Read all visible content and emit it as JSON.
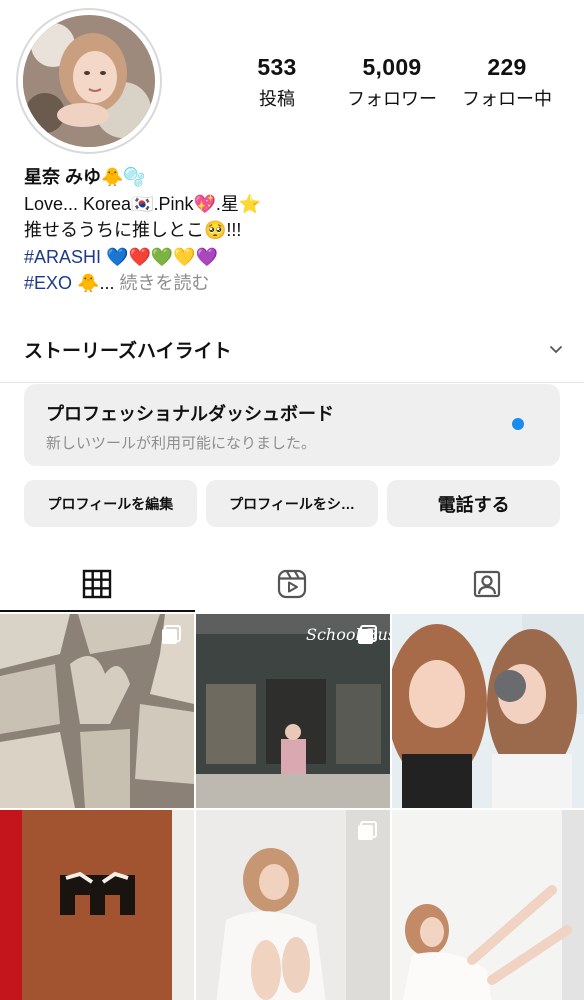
{
  "stats": {
    "posts": {
      "num": "533",
      "label": "投稿"
    },
    "followers": {
      "num": "5,009",
      "label": "フォロワー"
    },
    "following": {
      "num": "229",
      "label": "フォロー中"
    }
  },
  "bio": {
    "name": "星奈 みゆ🐥🫧",
    "line1": "Love... Korea🇰🇷.Pink💖.星⭐",
    "line2": "推せるうちに推しとこ🥺!!!",
    "tag1": "#ARASHI",
    "tag1_emoji": " 💙❤️💚💛💜",
    "tag2": "#EXO",
    "tag2_emoji": " 🐥...",
    "more": "続きを読む"
  },
  "highlights": {
    "title": "ストーリーズハイライト"
  },
  "dashboard": {
    "title": "プロフェッショナルダッシュボード",
    "subtitle": "新しいツールが利用可能になりました。"
  },
  "actions": {
    "edit": "プロフィールを編集",
    "share": "プロフィールをシ…",
    "call": "電話する"
  },
  "colors": {
    "accent": "#1a8cf0",
    "hashtag": "#1d3a8a",
    "button_bg": "#efefef"
  },
  "icons": [
    "grid-icon",
    "reels-icon",
    "tagged-icon",
    "chevron-down-icon",
    "multi-post-icon"
  ],
  "posts_visible": [
    {
      "kind": "stone-wall",
      "multi": true
    },
    {
      "kind": "storefront",
      "sign": "School Bus",
      "multi": true
    },
    {
      "kind": "selfie",
      "multi": false
    },
    {
      "kind": "rusted-sign",
      "multi": false
    },
    {
      "kind": "portrait-white",
      "multi": true
    },
    {
      "kind": "portrait-studio",
      "multi": false
    }
  ]
}
